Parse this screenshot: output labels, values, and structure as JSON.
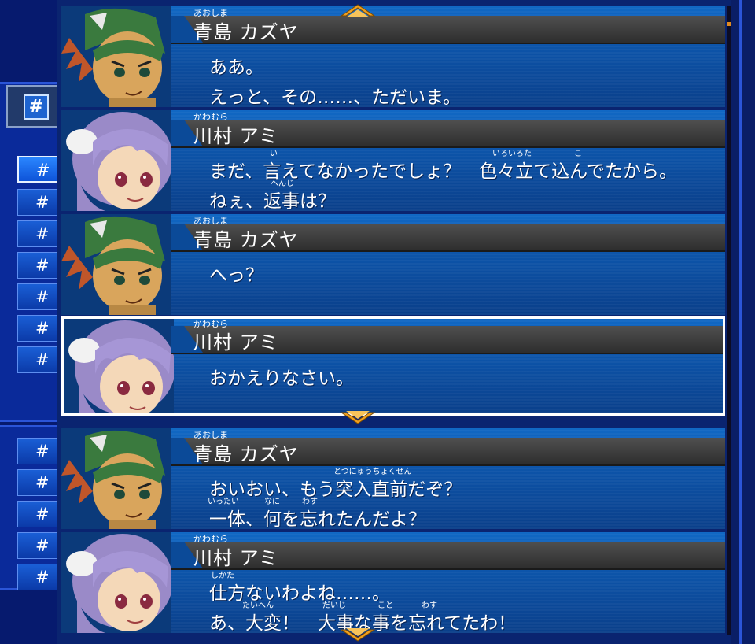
{
  "menu": {
    "head_icon": "#",
    "items": [
      "#",
      "#",
      "#",
      "#",
      "#",
      "#",
      "#"
    ],
    "items_lower": [
      "#",
      "#",
      "#",
      "#",
      "#"
    ]
  },
  "log": {
    "entries": [
      {
        "speaker_ruby": "あおしま",
        "speaker": "青島 カズヤ",
        "portrait": "kazuya-portrait",
        "lines": [
          "ああ。",
          "えっと、その……、ただいま。"
        ],
        "rubies": []
      },
      {
        "speaker_ruby": "かわむら",
        "speaker": "川村 アミ",
        "portrait": "ami-portrait",
        "lines": [
          "まだ、言えてなかったでしょ？　色々立て込んでたから。",
          "ねぇ、返事は？"
        ],
        "rubies": [
          "い",
          "いろいろた",
          "こ",
          "へんじ"
        ]
      },
      {
        "speaker_ruby": "あおしま",
        "speaker": "青島 カズヤ",
        "portrait": "kazuya-portrait",
        "lines": [
          "へっ？",
          ""
        ],
        "rubies": []
      },
      {
        "speaker_ruby": "かわむら",
        "speaker": "川村 アミ",
        "portrait": "ami-portrait",
        "lines": [
          "おかえりなさい。",
          ""
        ],
        "rubies": [],
        "selected": true
      },
      {
        "speaker_ruby": "あおしま",
        "speaker": "青島 カズヤ",
        "portrait": "kazuya-portrait",
        "lines": [
          "おいおい、もう突入直前だぞ？",
          "一体、何を忘れたんだよ？"
        ],
        "rubies": [
          "とつにゅうちょくぜん",
          "いったい",
          "なに",
          "わす"
        ]
      },
      {
        "speaker_ruby": "かわむら",
        "speaker": "川村 アミ",
        "portrait": "ami-portrait",
        "lines": [
          "仕方ないわよね……。",
          "あ、大変！　大事な事を忘れてたわ！"
        ],
        "rubies": [
          "しかた",
          "たいへん",
          "だいじ",
          "こと",
          "わす"
        ]
      }
    ]
  },
  "colors": {
    "background": "#061a6e",
    "entry_blue": "#0d56ac",
    "namebar": "#3c3c3c",
    "arrow": "#f0a020"
  }
}
